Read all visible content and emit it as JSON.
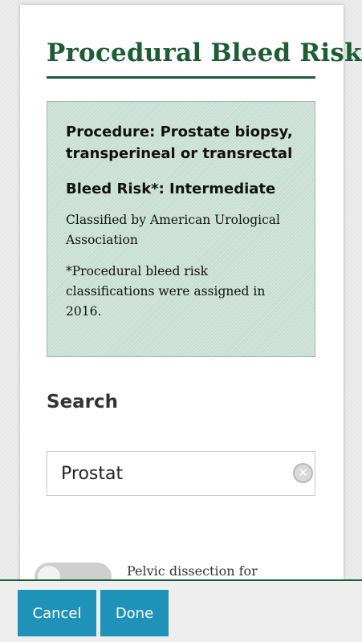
{
  "header": {
    "title": "Procedural Bleed Risk"
  },
  "info": {
    "procedure": "Procedure: Prostate biopsy, transperineal or transrectal",
    "bleed_risk": "Bleed Risk*: Intermediate",
    "classified_by": "Classified by American Urological Association",
    "note": "*Procedural bleed risk classifications were assigned in 2016."
  },
  "search": {
    "heading": "Search",
    "value": "Prostat"
  },
  "results": [
    {
      "label": "Pelvic dissection for",
      "toggled": false
    }
  ],
  "footer": {
    "cancel_label": "Cancel",
    "done_label": "Done"
  },
  "colors": {
    "brand_green": "#1e5c35",
    "info_bg": "#c6ddd2",
    "button_blue": "#1f92ba"
  }
}
